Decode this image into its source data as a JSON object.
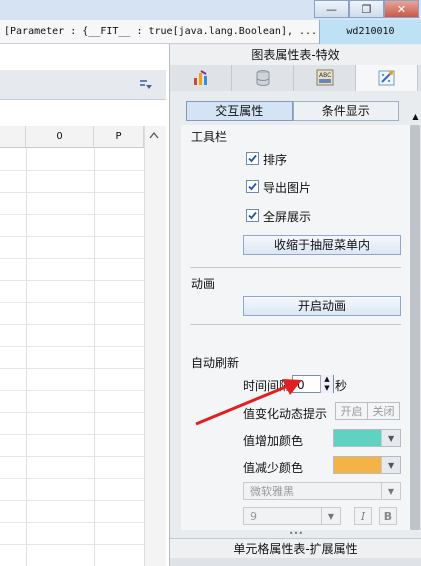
{
  "window": {
    "minimize_glyph": "—",
    "restore_glyph": "❐",
    "close_glyph": "✕",
    "param_text": "[Parameter : {__FIT__ : true[java.lang.Boolean], ...",
    "tab_label": "wd210010"
  },
  "sheet": {
    "columns": [
      "0",
      "P"
    ]
  },
  "panel": {
    "title": "图表属性表-特效",
    "tools": [
      "chart-type-icon",
      "data-icon",
      "style-icon",
      "effects-icon"
    ],
    "tabs": [
      "交互属性",
      "条件显示"
    ],
    "toolbar_section": {
      "heading": "工具栏",
      "options": [
        {
          "label": "排序",
          "checked": true
        },
        {
          "label": "导出图片",
          "checked": true
        },
        {
          "label": "全屏展示",
          "checked": true
        }
      ],
      "collapse_button": "收缩于抽屉菜单内"
    },
    "animation_section": {
      "heading": "动画",
      "button": "开启动画"
    },
    "autorefresh_section": {
      "heading": "自动刷新",
      "interval_label": "时间间隔",
      "interval_value": "0",
      "interval_unit": "秒",
      "change_hint_label": "值变化动态提示",
      "change_hint_on": "开启",
      "change_hint_off": "关闭",
      "increase_color_label": "值增加颜色",
      "increase_color": "#5ed3c1",
      "decrease_color_label": "值减少颜色",
      "decrease_color": "#f4b346",
      "font_family_value": "微软雅黑",
      "font_size_value": "9",
      "italic_label": "I",
      "bold_label": "B"
    },
    "bottom_title": "单元格属性表-扩展属性",
    "splitter_glyph": "•••"
  },
  "annotation": {
    "arrow_color": "#e02020"
  }
}
